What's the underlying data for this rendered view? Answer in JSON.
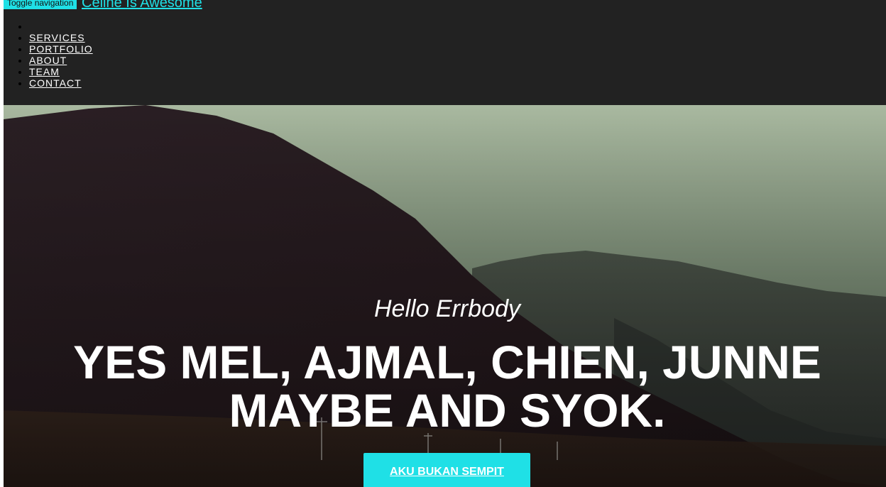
{
  "nav": {
    "toggle_label": "Toggle navigation",
    "brand": "Celine Is Awesome",
    "items": [
      {
        "label": "SERVICES"
      },
      {
        "label": "PORTFOLIO"
      },
      {
        "label": "ABOUT"
      },
      {
        "label": "TEAM"
      },
      {
        "label": "CONTACT"
      }
    ]
  },
  "hero": {
    "subtitle": "Hello Errbody",
    "title_line1": "YES MEL, AJMAL, CHIEN, JUNNE",
    "title_line2": "MAYBE AND SYOK.",
    "cta_label": "AKU BUKAN SEMPIT"
  },
  "colors": {
    "accent": "#1fe0e6",
    "nav_bg": "#222222",
    "text_light": "#ffffff"
  }
}
